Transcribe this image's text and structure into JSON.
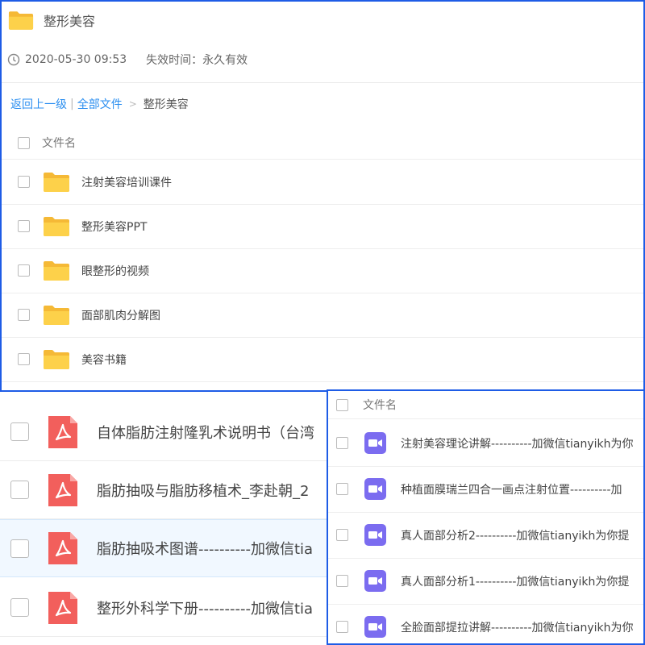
{
  "header": {
    "title": "整形美容"
  },
  "meta": {
    "timestamp": "2020-05-30 09:53",
    "expiry": "失效时间：永久有效"
  },
  "breadcrumb": {
    "back": "返回上一级",
    "all_files": "全部文件",
    "current": "整形美容"
  },
  "list_header": {
    "name_col": "文件名"
  },
  "folders": [
    {
      "name": "注射美容培训课件"
    },
    {
      "name": "整形美容PPT"
    },
    {
      "name": "眼整形的视频"
    },
    {
      "name": "面部肌肉分解图"
    },
    {
      "name": "美容书籍"
    }
  ],
  "pdf_files": [
    {
      "name": "自体脂肪注射隆乳术说明书（台湾"
    },
    {
      "name": "脂肪抽吸与脂肪移植术_李赴朝_2"
    },
    {
      "name": "脂肪抽吸术图谱----------加微信tia"
    },
    {
      "name": "整形外科学下册----------加微信tia"
    }
  ],
  "video_panel": {
    "name_col": "文件名",
    "files": [
      {
        "name": "注射美容理论讲解----------加微信tianyikh为你"
      },
      {
        "name": "种植面膜瑞兰四合一画点注射位置----------加"
      },
      {
        "name": "真人面部分析2----------加微信tianyikh为你提"
      },
      {
        "name": "真人面部分析1----------加微信tianyikh为你提"
      },
      {
        "name": "全脸面部提拉讲解----------加微信tianyikh为你"
      }
    ]
  },
  "colors": {
    "accent": "#2a8ef0",
    "highlight_border": "#1e5ce6",
    "folder": "#fdd14a",
    "pdf": "#f25f5c",
    "video": "#7b6cf0"
  },
  "icons": [
    "folder-icon",
    "clock-icon",
    "pdf-icon",
    "video-icon"
  ]
}
